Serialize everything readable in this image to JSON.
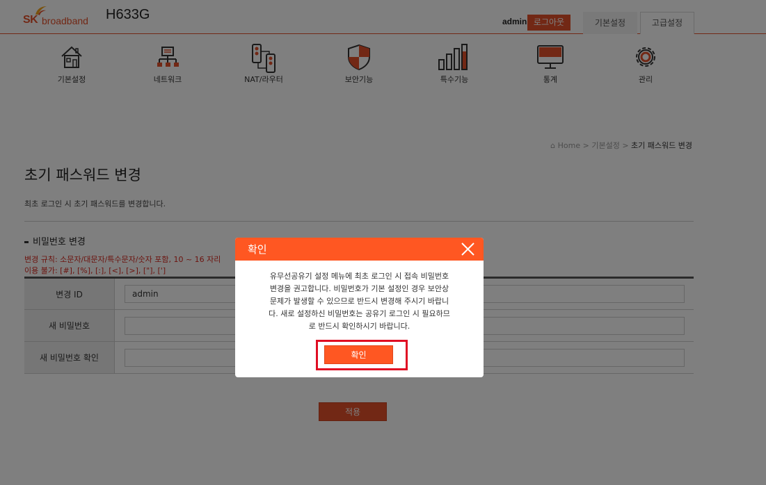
{
  "header": {
    "logo_sk": "SK",
    "logo_broadband": "broadband",
    "model": "H633G",
    "user": "admin",
    "logout_label": "로그아웃",
    "tabs": [
      {
        "label": "기본설정"
      },
      {
        "label": "고급설정"
      }
    ]
  },
  "nav": {
    "items": [
      {
        "label": "기본설정",
        "icon": "house-icon"
      },
      {
        "label": "네트워크",
        "icon": "network-icon"
      },
      {
        "label": "NAT/라우터",
        "icon": "router-icon"
      },
      {
        "label": "보안기능",
        "icon": "shield-icon"
      },
      {
        "label": "특수기능",
        "icon": "bars-icon"
      },
      {
        "label": "통계",
        "icon": "monitor-icon"
      },
      {
        "label": "관리",
        "icon": "gear-icon"
      }
    ]
  },
  "breadcrumb": {
    "home": "Home",
    "sep": ">",
    "parent": "기본설정",
    "current": "초기 패스워드 변경"
  },
  "page": {
    "title": "초기 패스워드 변경",
    "description": "최초 로그인 시 초기 패스워드를 변경합니다."
  },
  "section": {
    "title": "비밀번호 변경",
    "rule1": "변경 규칙: 소문자/대문자/특수문자/숫자 포함, 10 ~ 16 자리",
    "rule2": "이용 불가: [#], [%], [:], [<], [>], [\"], [']"
  },
  "form": {
    "rows": [
      {
        "label": "변경 ID",
        "value": "admin"
      },
      {
        "label": "새 비밀번호",
        "value": ""
      },
      {
        "label": "새 비밀번호 확인",
        "value": ""
      }
    ],
    "apply_label": "적용"
  },
  "modal": {
    "title": "확인",
    "lines": [
      "유무선공유기 설정 메뉴에 최초 로그인 시 접속 비밀번호",
      "변경을 권고합니다. 비밀번호가 기본 설정인 경우 보안상",
      "문제가 발생할 수 있으므로 반드시 변경해 주시기 바랍니",
      "다. 새로 설정하신 비밀번호는 공유기 로그인 시 필요하므",
      "로 반드시 확인하시기 바랍니다."
    ],
    "ok_label": "확인"
  },
  "colors": {
    "accent": "#ff5722",
    "brand": "#e4502a",
    "highlight": "#e00d23",
    "rule_text": "#d8281f"
  }
}
